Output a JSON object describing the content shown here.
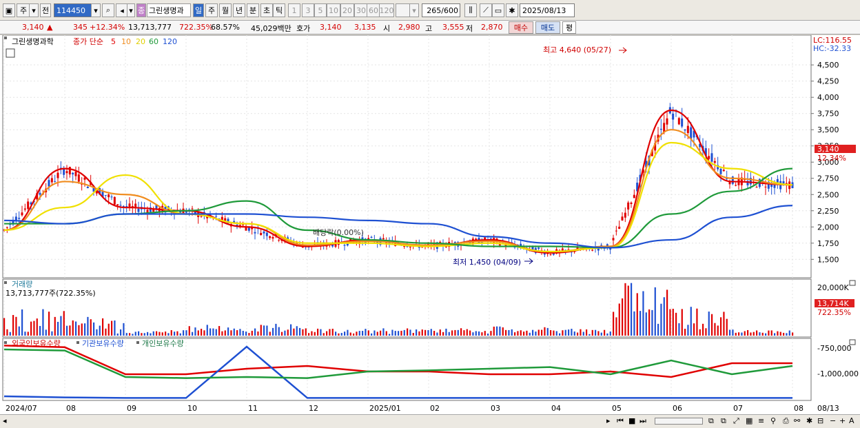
{
  "toolbar": {
    "market": "주",
    "type": "전",
    "code": "114450",
    "name_badge": "종",
    "name": "그린생명과",
    "periods": [
      "일",
      "주",
      "월",
      "년",
      "분",
      "초",
      "틱"
    ],
    "active_period": "일",
    "intervals": [
      "1",
      "3",
      "5",
      "10",
      "20",
      "30",
      "60",
      "120"
    ],
    "count": "265",
    "count_total": "/600",
    "date": "2025/08/13"
  },
  "quote": {
    "price": "3,140",
    "change": "345",
    "change_pct": "+12.34%",
    "volume": "13,713,777",
    "vol_pct": "722.35%",
    "turnover": "68.57%",
    "amount": "45,029백만",
    "hoga_label": "호가",
    "hoga": "3,140",
    "hoga2": "3,135",
    "open_label": "시",
    "open": "2,980",
    "high_label": "고",
    "high": "3,555",
    "low_label": "저",
    "low": "2,870",
    "buy": "매수",
    "sell": "매도",
    "eval": "평"
  },
  "legend": {
    "name": "그린생명과학",
    "type": "종가 단순",
    "ma": [
      {
        "label": "5",
        "color": "#e00000"
      },
      {
        "label": "10",
        "color": "#f08c1e"
      },
      {
        "label": "20",
        "color": "#f0e000"
      },
      {
        "label": "60",
        "color": "#1f9a3a"
      },
      {
        "label": "120",
        "color": "#1e50d2"
      }
    ]
  },
  "axis": {
    "lc": "LC:116.55",
    "hc": "HC:-32.33",
    "price_ticks": [
      "4,500",
      "4,250",
      "4,000",
      "3,750",
      "3,500",
      "3,250",
      "3,000",
      "2,750",
      "2,500",
      "2,250",
      "2,000",
      "1,750",
      "1,500"
    ],
    "price_tag": "3,140",
    "price_tag_pct": "12.34%",
    "vol_ticks": [
      "20,000K",
      "13,714K",
      "722.35%"
    ],
    "inv_ticks": [
      "-750,000",
      "-1,000,000"
    ]
  },
  "annotations": {
    "high": "최고 4,640 (05/27)",
    "low": "최저 1,450 (04/09)",
    "dividend": "배당락(0.00%)"
  },
  "volume_panel": {
    "title": "거래량",
    "value": "13,713,777주(722.35%)"
  },
  "investor_panel": {
    "titles": [
      "외국인보유수량",
      "기관보유수량",
      "개인보유수량"
    ]
  },
  "x_axis": {
    "labels": [
      "2024/07",
      "08",
      "09",
      "10",
      "11",
      "12",
      "2025/01",
      "02",
      "03",
      "04",
      "05",
      "06",
      "07",
      "08"
    ],
    "right_label": "08/13"
  },
  "colors": {
    "up": "#e00000",
    "down": "#1e50d2",
    "ma5": "#e00000",
    "ma10": "#f08c1e",
    "ma20": "#f0e000",
    "ma60": "#1f9a3a",
    "ma120": "#1e50d2"
  },
  "chart_data": {
    "type": "line",
    "title": "그린생명과학",
    "x": [
      "2024/07",
      "08",
      "09",
      "10",
      "11",
      "12",
      "2025/01",
      "02",
      "03",
      "04",
      "05",
      "06",
      "07",
      "08"
    ],
    "series": [
      {
        "name": "5",
        "values": [
          1950,
          2900,
          2300,
          2250,
          2000,
          1700,
          1800,
          1700,
          1800,
          1600,
          1700,
          3800,
          2700,
          2650
        ]
      },
      {
        "name": "10",
        "values": [
          1950,
          2700,
          2500,
          2200,
          2050,
          1720,
          1780,
          1720,
          1780,
          1620,
          1700,
          3500,
          2750,
          2650
        ]
      },
      {
        "name": "20",
        "values": [
          1950,
          2300,
          2800,
          2200,
          2050,
          1750,
          1750,
          1700,
          1750,
          1620,
          1680,
          3300,
          2900,
          2650
        ]
      },
      {
        "name": "60",
        "values": [
          2050,
          2050,
          2200,
          2250,
          2400,
          1950,
          1800,
          1750,
          1700,
          1700,
          1680,
          2200,
          2550,
          2900
        ]
      },
      {
        "name": "120",
        "values": [
          2100,
          2050,
          2200,
          2200,
          2200,
          2150,
          2100,
          2050,
          1850,
          1750,
          1680,
          1800,
          2150,
          2330
        ]
      }
    ],
    "ylim": [
      1450,
      4640
    ]
  }
}
